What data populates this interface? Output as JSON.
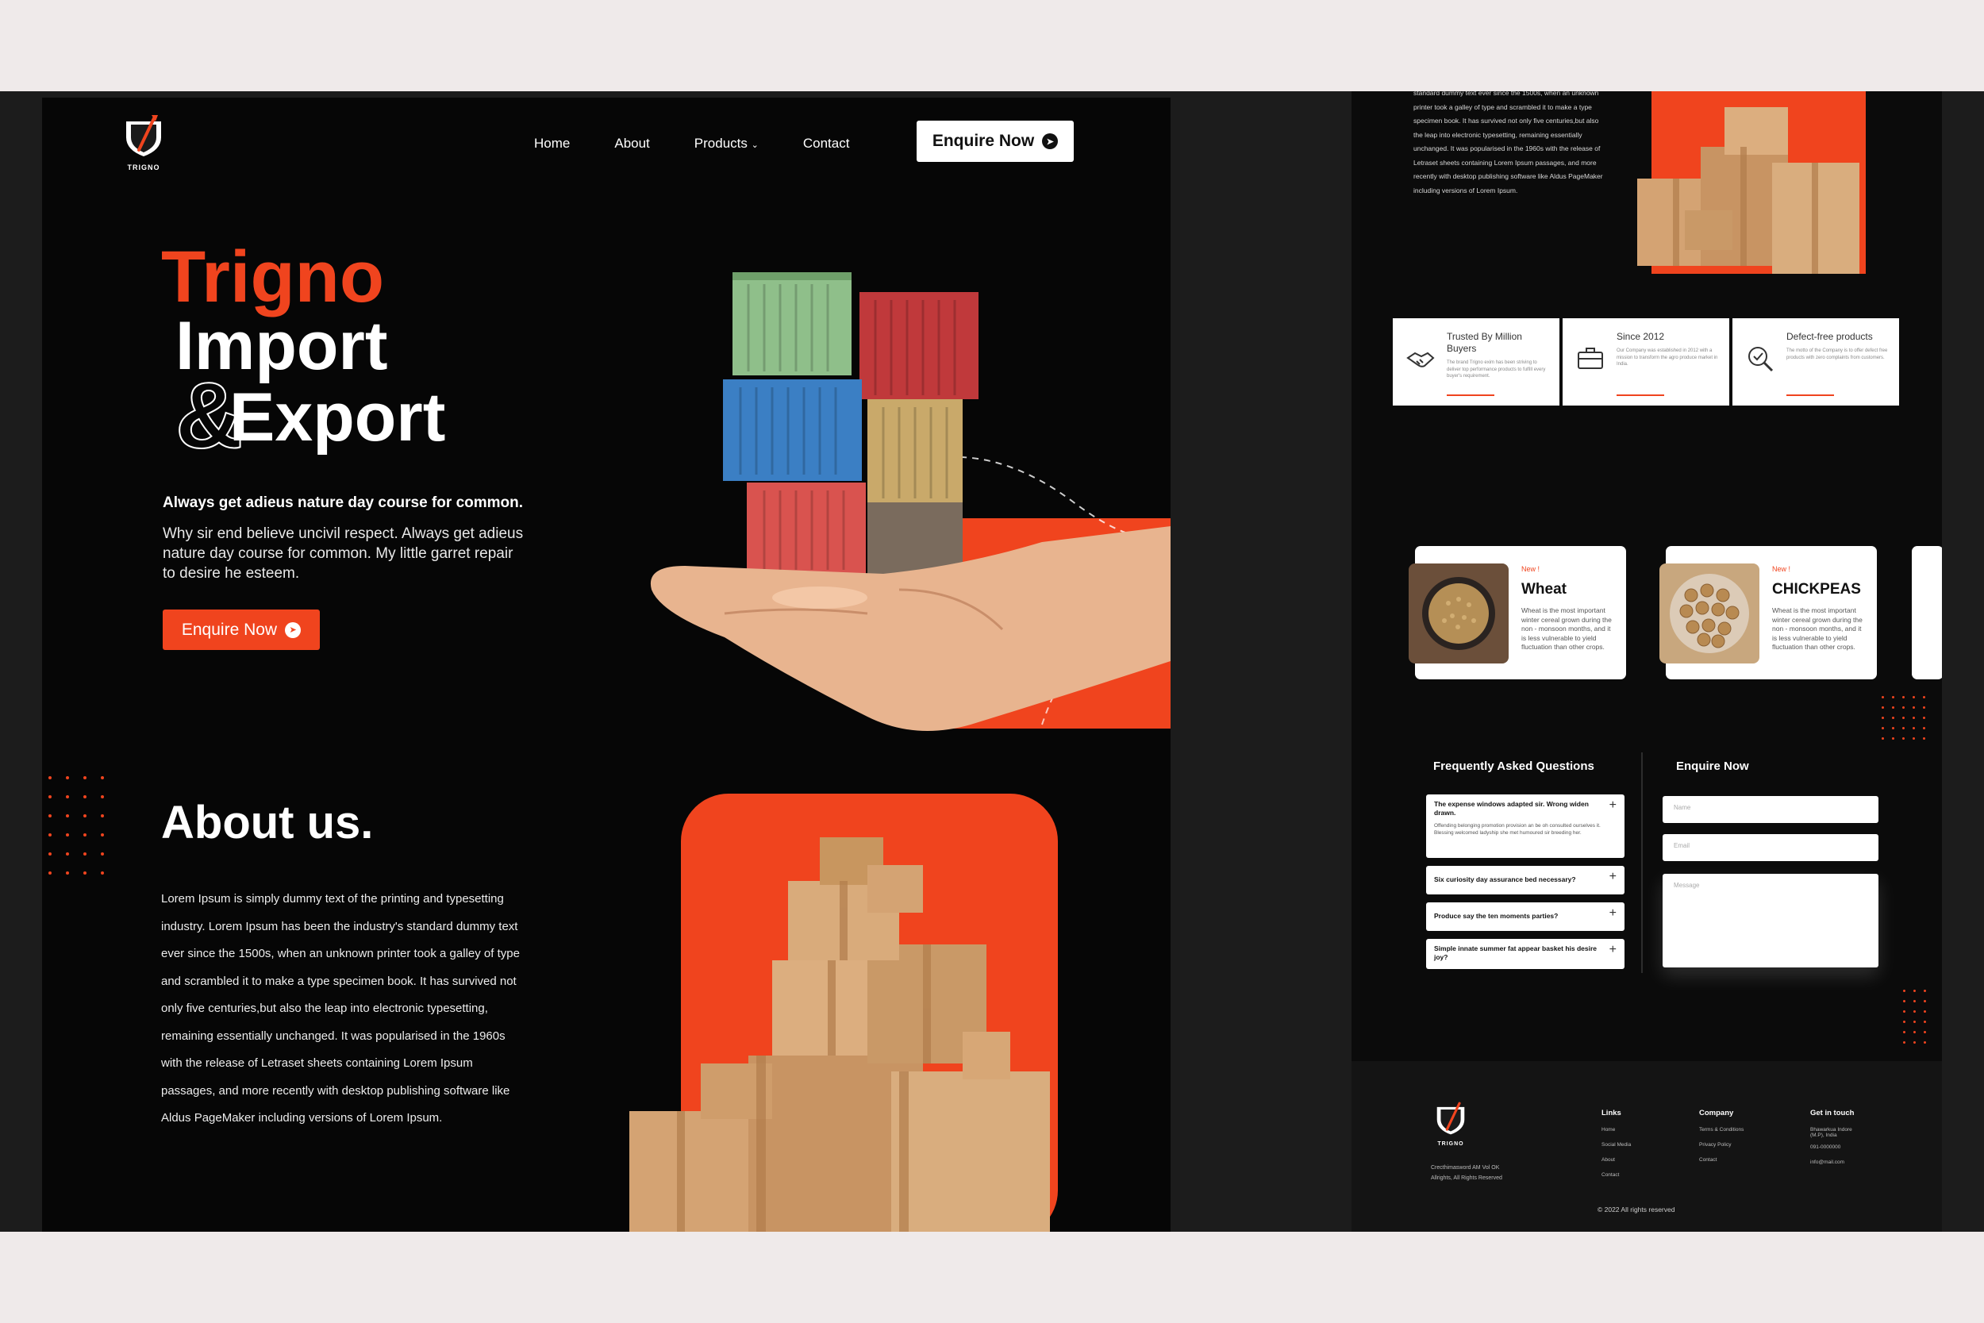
{
  "brand": {
    "name": "TRIGNO",
    "accent": "#f0441e"
  },
  "nav": {
    "items": [
      "Home",
      "About",
      "Products",
      "Contact"
    ],
    "cta": "Enquire Now"
  },
  "hero": {
    "line1": "Trigno",
    "line2": "Import",
    "amp": "&",
    "line3": "Export",
    "subtitle": "Always get adieus nature day course for common.",
    "description": "Why sir end believe uncivil respect. Always get adieus nature day course for common. My little garret repair to desire he esteem.",
    "cta": "Enquire Now"
  },
  "about": {
    "title": "About us.",
    "text": "Lorem Ipsum is simply dummy text of the printing and typesetting industry. Lorem Ipsum has been the industry's standard dummy text ever since the 1500s, when an unknown printer took a galley of type and scrambled it to make a type specimen book. It has survived not only five centuries,but also the leap into electronic typesetting, remaining essentially unchanged. It was popularised in the 1960s with the release of Letraset sheets containing Lorem Ipsum passages, and more recently with desktop publishing software like Aldus PageMaker including versions of Lorem Ipsum."
  },
  "right": {
    "about_text": "standard dummy text ever since the 1500s, when an unknown printer took a galley of type and scrambled it to make a type specimen book. It has survived not only five centuries,but also the leap into electronic typesetting, remaining essentially unchanged. It was popularised in the 1960s with the release of Letraset sheets containing Lorem Ipsum passages, and more recently with desktop publishing software like Aldus PageMaker including versions of Lorem Ipsum.",
    "features": [
      {
        "title": "Trusted By Million Buyers",
        "desc": "The brand Trigno exim has been striving to deliver top performance products to fulfill every buyer's requirement.",
        "icon": "handshake-icon"
      },
      {
        "title": "Since 2012",
        "desc": "Our Company was established in 2012 with a mission to transform the agro produce market in India.",
        "icon": "briefcase-icon"
      },
      {
        "title": "Defect-free products",
        "desc": "The motto of the Company is to offer defect free products with zero complaints from customers.",
        "icon": "inspect-icon"
      }
    ],
    "products": [
      {
        "badge": "New !",
        "name": "Wheat",
        "desc": "Wheat is the most important winter cereal grown during the non - monsoon months, and it is less vulnerable to yield fluctuation than other crops."
      },
      {
        "badge": "New !",
        "name": "CHICKPEAS",
        "desc": "Wheat is the most important winter cereal grown during the non - monsoon months, and it is less vulnerable to yield fluctuation than other crops."
      }
    ],
    "faq": {
      "title": "Frequently Asked Questions",
      "items": [
        {
          "q": "The expense windows adapted sir. Wrong widen drawn.",
          "a": "Offending belonging promotion provision an be oh consulted ourselves it. Blessing welcomed ladyship she met humoured sir breeding her."
        },
        {
          "q": "Six curiosity day assurance bed necessary?",
          "a": ""
        },
        {
          "q": "Produce say the ten moments parties?",
          "a": ""
        },
        {
          "q": "Simple innate summer fat appear basket his desire joy?",
          "a": ""
        }
      ]
    },
    "enquiry": {
      "title": "Enquire Now",
      "name_placeholder": "Name",
      "email_placeholder": "Email",
      "message_placeholder": "Message"
    },
    "footer": {
      "address": [
        "Crecthimasword AM Vol OK",
        "Allrights, All Rights Reserved"
      ],
      "columns": [
        {
          "head": "Links",
          "items": [
            "Home",
            "Social Media",
            "About",
            "Contact"
          ]
        },
        {
          "head": "Company",
          "items": [
            "Terms & Conditions",
            "Privacy Policy",
            "Contact"
          ]
        },
        {
          "head": "Get in touch",
          "items": [
            "Bhawarkua Indore (M.P), India",
            "091-0000000",
            "info@mail.com"
          ]
        }
      ],
      "copyright": "© 2022  All rights reserved"
    }
  }
}
